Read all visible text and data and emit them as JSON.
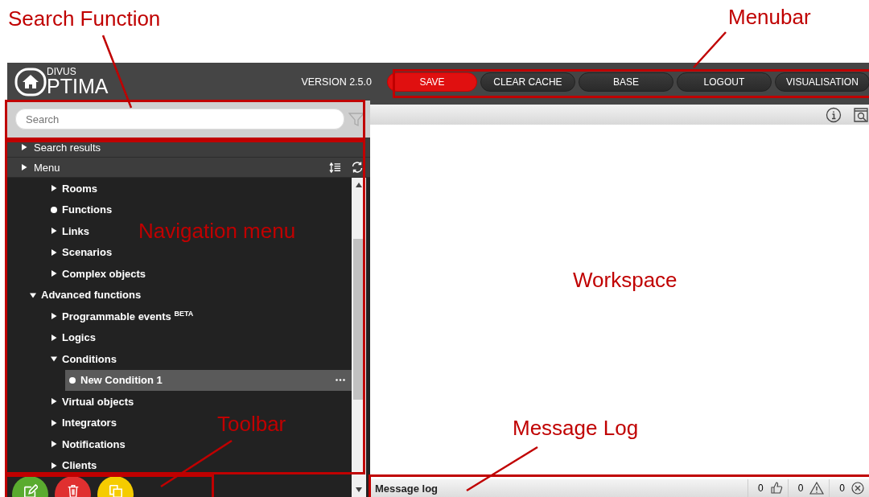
{
  "header": {
    "logo": {
      "small": "DIVUS",
      "large": "PTIMA"
    },
    "version": "VERSION 2.5.0"
  },
  "menubar": [
    {
      "label": "SAVE",
      "kind": "primary"
    },
    {
      "label": "CLEAR CACHE",
      "kind": "default"
    },
    {
      "label": "BASE",
      "kind": "default"
    },
    {
      "label": "LOGOUT",
      "kind": "default"
    },
    {
      "label": "VISUALISATION",
      "kind": "default"
    }
  ],
  "search": {
    "placeholder": "Search"
  },
  "sections": [
    {
      "label": "Search results",
      "expanded": false,
      "tools": false
    },
    {
      "label": "Menu",
      "expanded": false,
      "tools": true
    }
  ],
  "nav_tree": {
    "orphan_children": [
      {
        "label": "Rooms",
        "kind": "branch",
        "expanded": false,
        "selected": false
      },
      {
        "label": "Functions",
        "kind": "leaf",
        "selected": false
      },
      {
        "label": "Links",
        "kind": "branch",
        "expanded": false,
        "selected": false
      },
      {
        "label": "Scenarios",
        "kind": "branch",
        "expanded": false,
        "selected": false
      },
      {
        "label": "Complex objects",
        "kind": "branch",
        "expanded": false,
        "selected": false
      }
    ],
    "items": [
      {
        "label": "Advanced functions",
        "kind": "branch",
        "expanded": true,
        "selected": false,
        "children": [
          {
            "label": "Programmable events $^{BETA}$",
            "kind": "branch",
            "expanded": false,
            "selected": false
          },
          {
            "label": "Logics",
            "kind": "branch",
            "expanded": false,
            "selected": false
          },
          {
            "label": "Conditions",
            "kind": "branch",
            "expanded": true,
            "selected": false,
            "children": [
              {
                "label": "New Condition 1",
                "kind": "leaf",
                "selected": true
              }
            ]
          },
          {
            "label": "Virtual objects",
            "kind": "branch",
            "expanded": false,
            "selected": false
          },
          {
            "label": "Integrators",
            "kind": "branch",
            "expanded": false,
            "selected": false
          },
          {
            "label": "Notifications",
            "kind": "branch",
            "expanded": false,
            "selected": false
          },
          {
            "label": "Clients",
            "kind": "branch",
            "expanded": false,
            "selected": false
          }
        ]
      }
    ]
  },
  "toolbar": [
    {
      "kind": "edit",
      "color": "#5aab2f"
    },
    {
      "kind": "delete",
      "color": "#e03030"
    },
    {
      "kind": "copy",
      "color": "#f5cc00"
    }
  ],
  "message_log": {
    "title": "Message log",
    "counters": [
      {
        "kind": "success",
        "count": "0"
      },
      {
        "kind": "warning",
        "count": "0"
      },
      {
        "kind": "error",
        "count": "0"
      }
    ]
  },
  "annotations": [
    {
      "label": "Search Function"
    },
    {
      "label": "Menubar"
    },
    {
      "label": "Navigation menu"
    },
    {
      "label": "Workspace"
    },
    {
      "label": "Toolbar"
    },
    {
      "label": "Message Log"
    }
  ]
}
